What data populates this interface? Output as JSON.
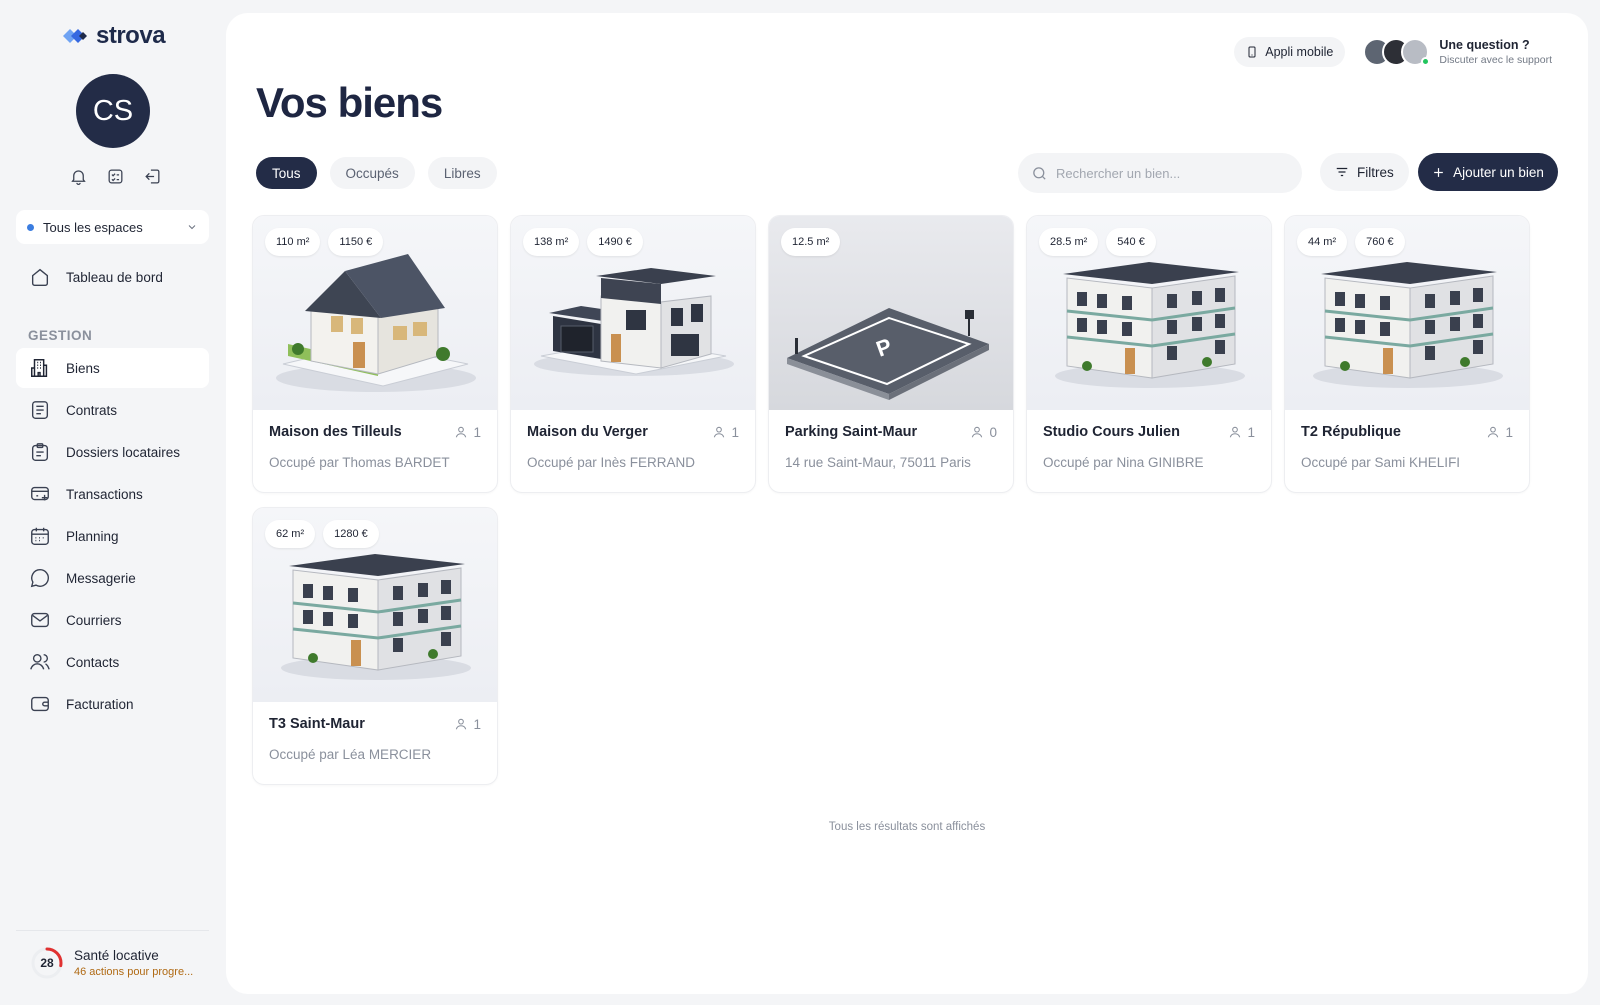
{
  "brand": {
    "name": "strova"
  },
  "user": {
    "initials": "CS"
  },
  "space_selector": {
    "label": "Tous les espaces",
    "dot_color": "#3b7de0"
  },
  "nav": {
    "dashboard": "Tableau de bord",
    "section": "GESTION",
    "items": [
      {
        "label": "Biens",
        "icon": "building-icon",
        "active": true
      },
      {
        "label": "Contrats",
        "icon": "contract-icon"
      },
      {
        "label": "Dossiers locataires",
        "icon": "clipboard-icon"
      },
      {
        "label": "Transactions",
        "icon": "transactions-icon"
      },
      {
        "label": "Planning",
        "icon": "calendar-icon"
      },
      {
        "label": "Messagerie",
        "icon": "chat-icon"
      },
      {
        "label": "Courriers",
        "icon": "mail-icon"
      },
      {
        "label": "Contacts",
        "icon": "contacts-icon"
      },
      {
        "label": "Facturation",
        "icon": "wallet-icon"
      }
    ]
  },
  "health": {
    "score": "28",
    "score_fraction": 0.28,
    "title": "Santé locative",
    "subtitle": "46 actions pour progre..."
  },
  "header": {
    "app_button": "Appli mobile",
    "support_title": "Une question ?",
    "support_subtitle": "Discuter avec le support"
  },
  "page": {
    "title": "Vos biens"
  },
  "tabs": [
    {
      "label": "Tous",
      "active": true
    },
    {
      "label": "Occupés"
    },
    {
      "label": "Libres"
    }
  ],
  "search": {
    "placeholder": "Rechercher un bien..."
  },
  "filters_label": "Filtres",
  "add_label": "Ajouter un bien",
  "properties": [
    {
      "name": "Maison des Tilleuls",
      "surface": "110 m²",
      "rent": "1150 €",
      "occupants": "1",
      "subtitle": "Occupé par Thomas BARDET",
      "image": "house"
    },
    {
      "name": "Maison du Verger",
      "surface": "138 m²",
      "rent": "1490 €",
      "occupants": "1",
      "subtitle": "Occupé par Inès FERRAND",
      "image": "modern-house"
    },
    {
      "name": "Parking Saint-Maur",
      "surface": "12.5 m²",
      "occupants": "0",
      "subtitle": "14 rue Saint-Maur, 75011 Paris",
      "image": "parking"
    },
    {
      "name": "Studio Cours Julien",
      "surface": "28.5 m²",
      "rent": "540 €",
      "occupants": "1",
      "subtitle": "Occupé par Nina GINIBRE",
      "image": "apartment-building"
    },
    {
      "name": "T2 République",
      "surface": "44 m²",
      "rent": "760 €",
      "occupants": "1",
      "subtitle": "Occupé par Sami KHELIFI",
      "image": "apartment-building"
    },
    {
      "name": "T3 Saint-Maur",
      "surface": "62 m²",
      "rent": "1280 €",
      "occupants": "1",
      "subtitle": "Occupé par Léa MERCIER",
      "image": "apartment-building"
    }
  ],
  "footer_note": "Tous les résultats sont affichés"
}
